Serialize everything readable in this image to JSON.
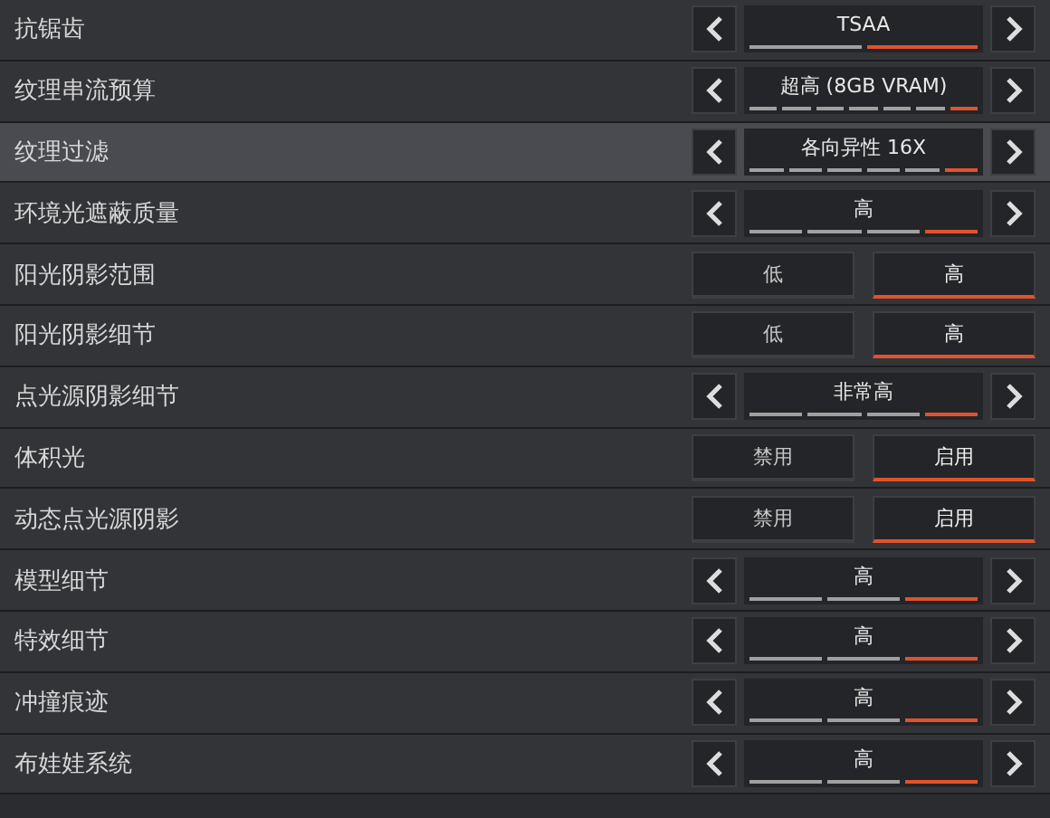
{
  "settings": [
    {
      "label": "抗锯齿",
      "kind": "selector",
      "highlighted": false,
      "value": "TSAA",
      "segments": [
        {
          "selected": false
        },
        {
          "selected": true
        }
      ]
    },
    {
      "label": "纹理串流预算",
      "kind": "selector",
      "highlighted": false,
      "value": "超高 (8GB VRAM)",
      "segments": [
        {
          "selected": false
        },
        {
          "selected": false
        },
        {
          "selected": false
        },
        {
          "selected": false
        },
        {
          "selected": false
        },
        {
          "selected": false
        },
        {
          "selected": true
        }
      ]
    },
    {
      "label": "纹理过滤",
      "kind": "selector",
      "highlighted": true,
      "value": "各向异性 16X",
      "segments": [
        {
          "selected": false
        },
        {
          "selected": false
        },
        {
          "selected": false
        },
        {
          "selected": false
        },
        {
          "selected": false
        },
        {
          "selected": true
        }
      ]
    },
    {
      "label": "环境光遮蔽质量",
      "kind": "selector",
      "highlighted": false,
      "value": "高",
      "segments": [
        {
          "selected": false
        },
        {
          "selected": false
        },
        {
          "selected": false
        },
        {
          "selected": true
        }
      ]
    },
    {
      "label": "阳光阴影范围",
      "kind": "toggle",
      "highlighted": false,
      "options": [
        {
          "label": "低",
          "selected": false
        },
        {
          "label": "高",
          "selected": true
        }
      ]
    },
    {
      "label": "阳光阴影细节",
      "kind": "toggle",
      "highlighted": false,
      "options": [
        {
          "label": "低",
          "selected": false
        },
        {
          "label": "高",
          "selected": true
        }
      ]
    },
    {
      "label": "点光源阴影细节",
      "kind": "selector",
      "highlighted": false,
      "value": "非常高",
      "segments": [
        {
          "selected": false
        },
        {
          "selected": false
        },
        {
          "selected": false
        },
        {
          "selected": true
        }
      ]
    },
    {
      "label": "体积光",
      "kind": "toggle",
      "highlighted": false,
      "options": [
        {
          "label": "禁用",
          "selected": false
        },
        {
          "label": "启用",
          "selected": true
        }
      ]
    },
    {
      "label": "动态点光源阴影",
      "kind": "toggle",
      "highlighted": false,
      "options": [
        {
          "label": "禁用",
          "selected": false
        },
        {
          "label": "启用",
          "selected": true
        }
      ]
    },
    {
      "label": "模型细节",
      "kind": "selector",
      "highlighted": false,
      "value": "高",
      "segments": [
        {
          "selected": false
        },
        {
          "selected": false
        },
        {
          "selected": true
        }
      ]
    },
    {
      "label": "特效细节",
      "kind": "selector",
      "highlighted": false,
      "value": "高",
      "segments": [
        {
          "selected": false
        },
        {
          "selected": false
        },
        {
          "selected": true
        }
      ]
    },
    {
      "label": "冲撞痕迹",
      "kind": "selector",
      "highlighted": false,
      "value": "高",
      "segments": [
        {
          "selected": false
        },
        {
          "selected": false
        },
        {
          "selected": true
        }
      ]
    },
    {
      "label": "布娃娃系统",
      "kind": "selector",
      "highlighted": false,
      "value": "高",
      "segments": [
        {
          "selected": false
        },
        {
          "selected": false
        },
        {
          "selected": true
        }
      ]
    }
  ]
}
